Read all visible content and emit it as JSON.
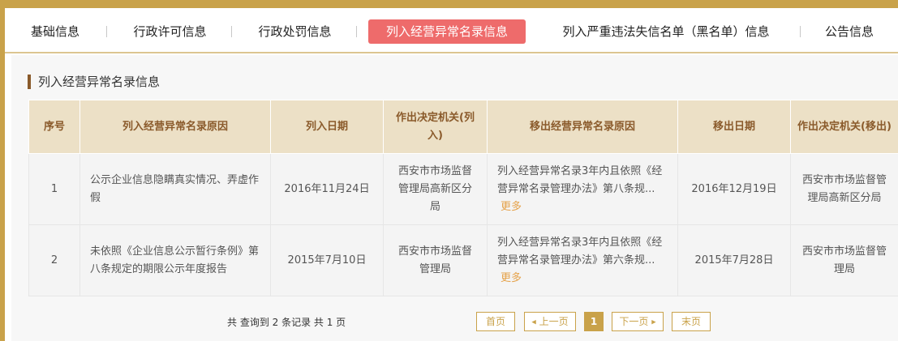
{
  "tabs": [
    {
      "label": "基础信息",
      "active": false
    },
    {
      "label": "行政许可信息",
      "active": false
    },
    {
      "label": "行政处罚信息",
      "active": false
    },
    {
      "label": "列入经营异常名录信息",
      "active": true
    },
    {
      "label": "列入严重违法失信名单（黑名单）信息",
      "active": false
    },
    {
      "label": "公告信息",
      "active": false
    }
  ],
  "section": {
    "title": "列入经营异常名录信息"
  },
  "table": {
    "headers": [
      "序号",
      "列入经营异常名录原因",
      "列入日期",
      "作出决定机关(列入)",
      "移出经营异常名录原因",
      "移出日期",
      "作出决定机关(移出)"
    ],
    "rows": [
      {
        "no": "1",
        "reason_in": "公示企业信息隐瞒真实情况、弄虚作假",
        "date_in": "2016年11月24日",
        "authority_in": "西安市市场监督管理局高新区分局",
        "reason_out": "列入经营异常名录3年内且依照《经营异常名录管理办法》第八条规...",
        "more": "更多",
        "date_out": "2016年12月19日",
        "authority_out": "西安市市场监督管理局高新区分局"
      },
      {
        "no": "2",
        "reason_in": "未依照《企业信息公示暂行条例》第八条规定的期限公示年度报告",
        "date_in": "2015年7月10日",
        "authority_in": "西安市市场监督管理局",
        "reason_out": "列入经营异常名录3年内且依照《经营异常名录管理办法》第六条规...",
        "more": "更多",
        "date_out": "2015年7月28日",
        "authority_out": "西安市市场监督管理局"
      }
    ]
  },
  "pagination": {
    "summary": "共 查询到 2 条记录 共 1 页",
    "first": "首页",
    "prev": "上一页",
    "current": "1",
    "next": "下一页",
    "last": "末页"
  },
  "colors": {
    "accent": "#c9a24a",
    "active_tab": "#ee6b6b",
    "header_bg": "#ece0c6",
    "header_text": "#8a5a2b",
    "more_link": "#e5a24a"
  }
}
